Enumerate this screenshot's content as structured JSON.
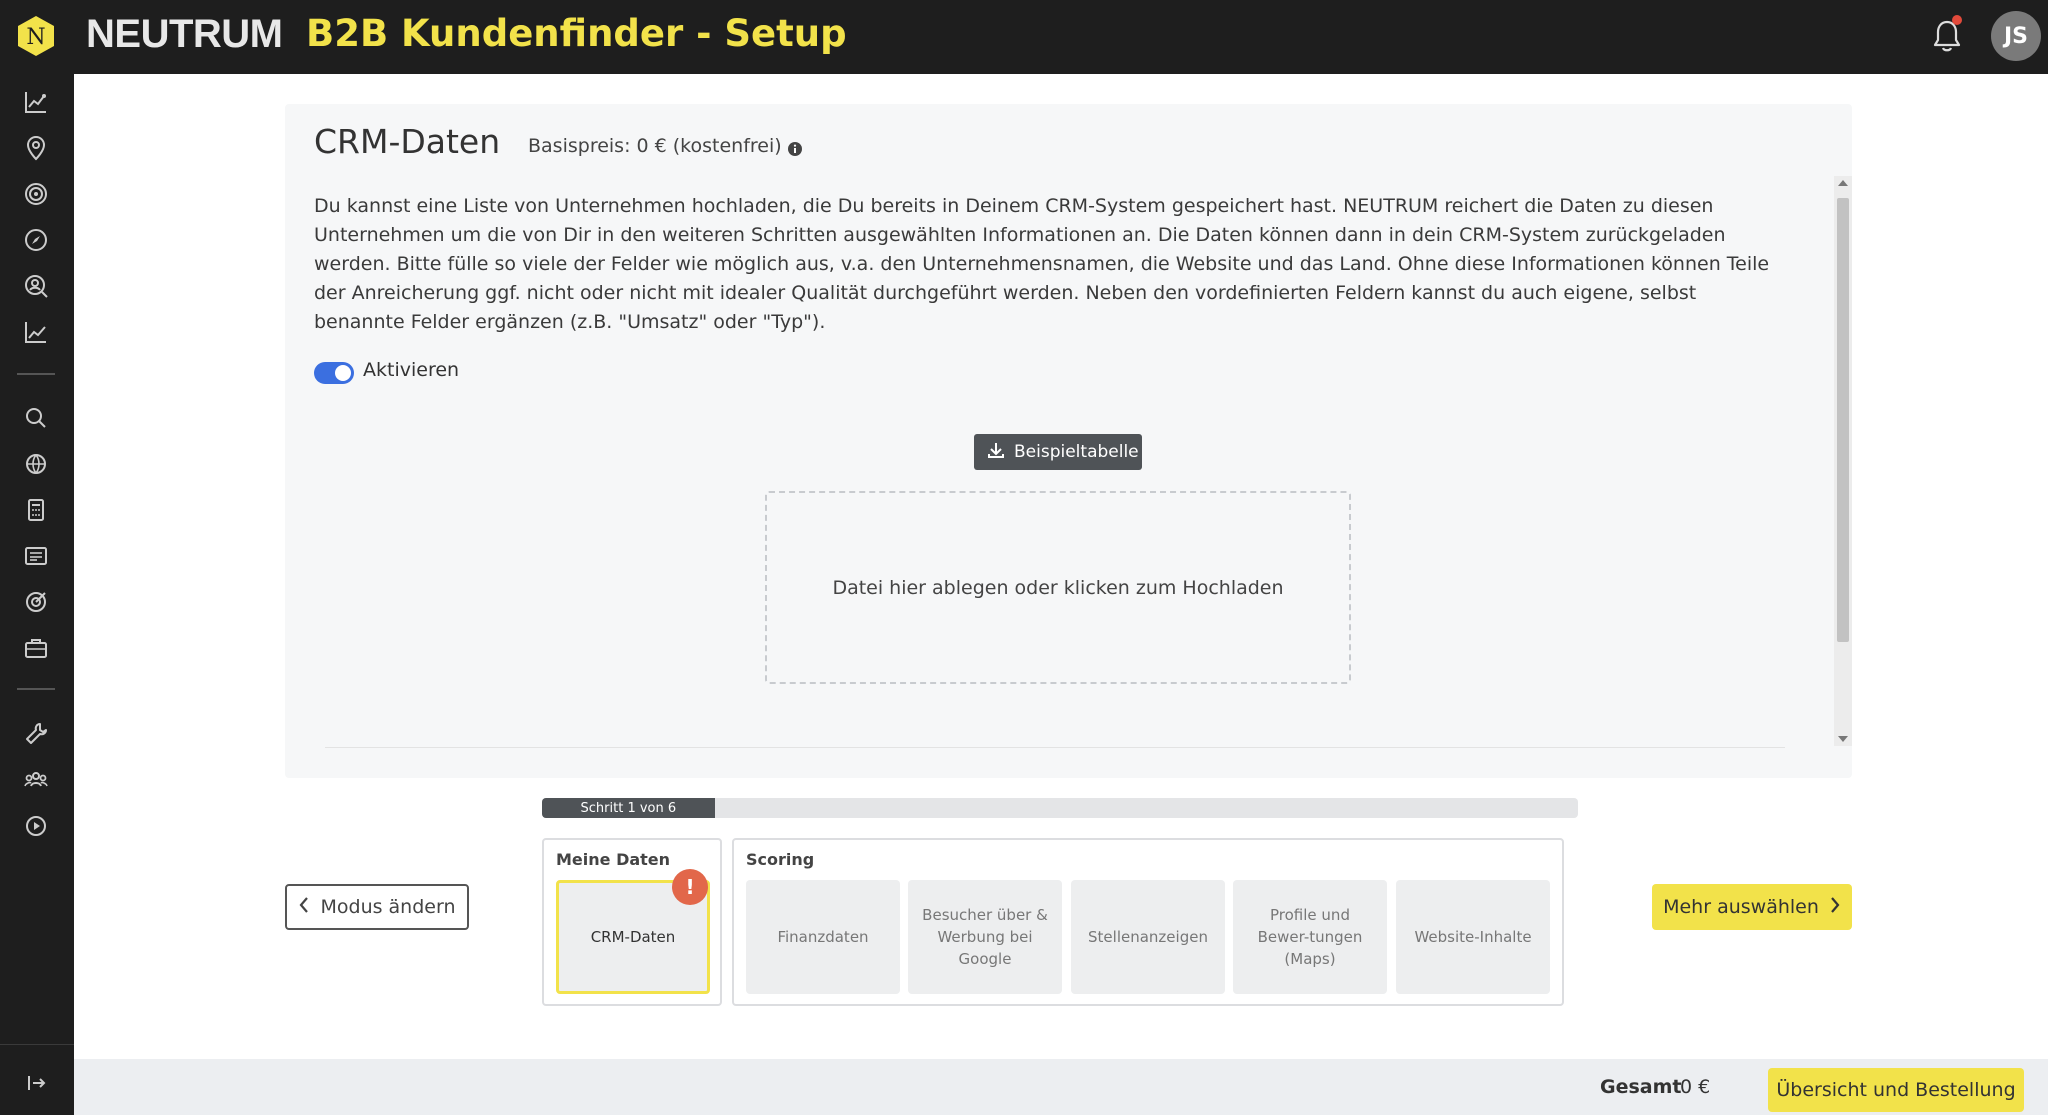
{
  "topbar": {
    "logo_letter": "N",
    "brand": "NEUTRUM",
    "title": "B2B Kundenfinder - Setup",
    "avatar_initials": "JS"
  },
  "sidebar": {
    "icons": [
      "dashboard-chart-icon",
      "location-pin-icon",
      "target-icon",
      "compass-icon",
      "user-search-icon",
      "line-chart-icon",
      "search-icon",
      "globe-icon",
      "calculator-icon",
      "news-icon",
      "goal-icon",
      "briefcase-icon",
      "wrench-icon",
      "team-icon",
      "play-circle-icon"
    ],
    "collapse_icon": "collapse-arrow-icon"
  },
  "card": {
    "title": "CRM-Daten",
    "price": "Basispreis: 0 € (kostenfrei)",
    "description": "Du kannst eine Liste von Unternehmen hochladen, die Du bereits in Deinem CRM-System gespeichert hast. NEUTRUM reichert die Daten zu diesen Unternehmen um die von Dir in den weiteren Schritten ausgewählten Informationen an. Die Daten können dann in dein CRM-System zurückgeladen werden. Bitte fülle so viele der Felder wie möglich aus, v.a. den Unternehmensnamen, die Website und das Land. Ohne diese Informationen können Teile der Anreicherung ggf. nicht oder nicht mit idealer Qualität durchgeführt werden. Neben den vordefinierten Feldern kannst du auch eigene, selbst benannte Felder ergänzen (z.B. \"Umsatz\" oder \"Typ\").",
    "toggle_label": "Aktivieren",
    "toggle_on": true,
    "sample_button": "Beispieltabelle",
    "dropzone_text": "Datei hier ablegen oder klicken zum Hochladen"
  },
  "progress": {
    "label": "Schritt 1 von 6",
    "current": 1,
    "total": 6
  },
  "steps": {
    "mode_button": "Modus ändern",
    "my_data": {
      "title": "Meine Daten",
      "tiles": [
        {
          "label": "CRM-Daten",
          "active": true
        }
      ],
      "badge": "!"
    },
    "scoring": {
      "title": "Scoring",
      "tiles": [
        {
          "label": "Finanzdaten"
        },
        {
          "label": "Besucher über & Werbung bei Google"
        },
        {
          "label": "Stellenanzeigen"
        },
        {
          "label": "Profile und Bewer-tungen (Maps)"
        },
        {
          "label": "Website-Inhalte"
        }
      ]
    },
    "more_button": "Mehr auswählen"
  },
  "footer": {
    "total_label": "Gesamt",
    "total_value": "0 €",
    "order_button": "Übersicht und Bestellung"
  },
  "colors": {
    "accent": "#f2e24a",
    "toggle": "#3b6fe0",
    "badge": "#e2674a",
    "dark": "#1e1e1e"
  }
}
